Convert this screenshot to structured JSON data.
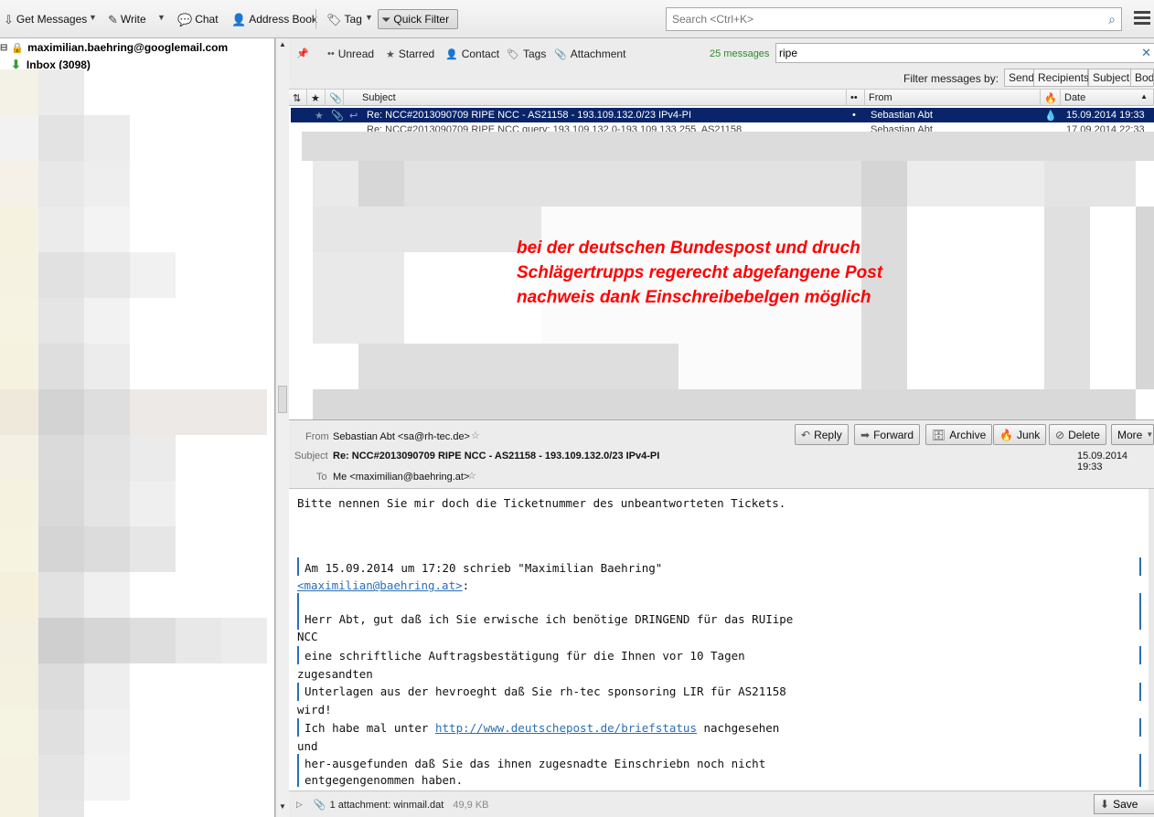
{
  "toolbar": {
    "get_messages": "Get Messages",
    "write": "Write",
    "chat": "Chat",
    "address_book": "Address Book",
    "tag": "Tag",
    "quick_filter": "Quick Filter",
    "search_placeholder": "Search <Ctrl+K>"
  },
  "folders": {
    "account": "maximilian.baehring@googlemail.com",
    "inbox": "Inbox (3098)"
  },
  "quick_filter_bar": {
    "unread": "Unread",
    "starred": "Starred",
    "contact": "Contact",
    "tags": "Tags",
    "attachment": "Attachment",
    "count": "25 messages",
    "search_value": "ripe",
    "filter_by_label": "Filter messages by:",
    "chips": [
      "Sender",
      "Recipients",
      "Subject",
      "Body"
    ]
  },
  "thread_pane": {
    "columns": {
      "subject": "Subject",
      "from": "From",
      "date": "Date"
    },
    "selected_row": {
      "subject": "Re: NCC#2013090709 RIPE NCC - AS21158 - 193.109.132.0/23 IPv4-PI",
      "from": "Sebastian Abt",
      "date": "15.09.2014 19:33"
    },
    "partial_row": {
      "subject": "Re: NCC#2013090709 RIPE NCC query: 193.109.132.0-193.109.133.255, AS21158",
      "from": "Sebastian Abt",
      "date": "17.09.2014 22:33"
    },
    "annotation": [
      "bei der deutschen Bundespost und druch",
      "Schlägertrupps regerecht abgefangene Post",
      "nachweis dank Einschreibebelgen möglich"
    ]
  },
  "message_header": {
    "from_label": "From",
    "from_value": "Sebastian Abt <sa@rh-tec.de>",
    "subject_label": "Subject",
    "subject_value": "Re: NCC#2013090709 RIPE NCC - AS21158 - 193.109.132.0/23 IPv4-PI",
    "to_label": "To",
    "to_value": "Me <maximilian@baehring.at>",
    "date": "15.09.2014 19:33",
    "buttons": {
      "reply": "Reply",
      "forward": "Forward",
      "archive": "Archive",
      "junk": "Junk",
      "delete": "Delete",
      "more": "More"
    }
  },
  "message_body": {
    "line1": "Bitte nennen Sie mir doch die Ticketnummer des unbeantworteten Tickets.",
    "q1": "Am 15.09.2014 um 17:20 schrieb \"Maximilian Baehring\"",
    "q1_link": "<maximilian@baehring.at>",
    "q1_colon": ":",
    "q2": "Herr Abt, gut daß ich Sie erwische ich benötige DRINGEND für das RUIipe",
    "q2_wrap": "NCC",
    "q3": "eine schriftliche Auftragsbestätigung für die Ihnen vor 10 Tagen",
    "q3_wrap": "zugesandten",
    "q4": "Unterlagen aus der hevroeght daß Sie rh-tec sponsoring LIR für AS21158",
    "q4_wrap": "wird!",
    "q5_pre": "Ich habe mal unter ",
    "q5_link": "http://www.deutschepost.de/briefstatus",
    "q5_post": " nachgesehen",
    "q5_wrap": "und",
    "q6": "her-ausgefunden daß Sie das ihnen zugesnadte Einschriebn noch nicht",
    "q6b": "entgegengenommen haben."
  },
  "attachment_bar": {
    "label": "1 attachment: winmail.dat",
    "size": "49,9 KB",
    "save": "Save"
  }
}
